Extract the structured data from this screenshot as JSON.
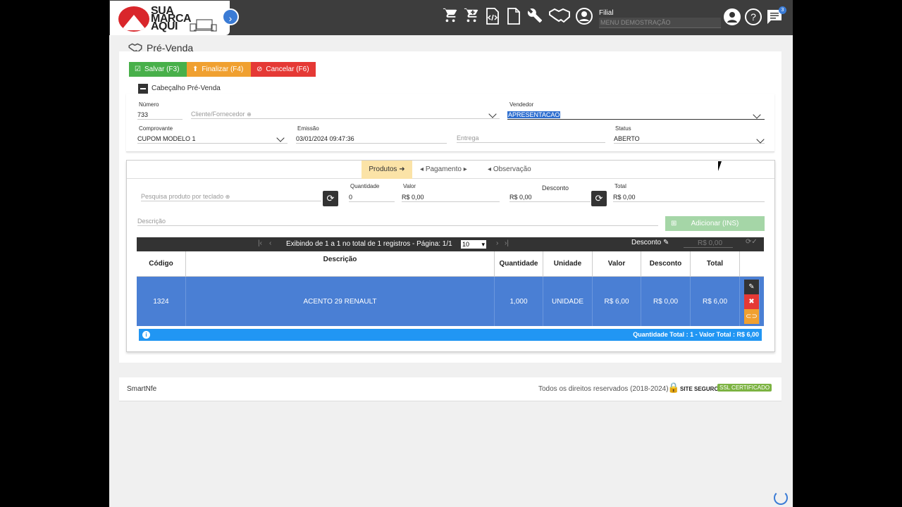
{
  "brand": {
    "logo_text_1": "SUA",
    "logo_text_2": "MARCA",
    "logo_text_3": "AQUI"
  },
  "header": {
    "filial_label": "Filial",
    "filial_value": "MENU DEMOSTRAÇÃO",
    "notification_count": "3"
  },
  "page": {
    "title": "Pré-Venda"
  },
  "toolbar": {
    "save_label": "Salvar (F3)",
    "finalize_label": "Finalizar (F4)",
    "cancel_label": "Cancelar (F6)"
  },
  "cabecalho": {
    "section_title": "Cabeçalho Pré-Venda",
    "numero_label": "Número",
    "numero_value": "733",
    "cliente_placeholder": "Cliente/Fornecedor",
    "vendedor_label": "Vendedor",
    "vendedor_value": "APRESENTACAO",
    "comprovante_label": "Comprovante",
    "comprovante_value": "CUPOM MODELO 1",
    "emissao_label": "Emissão",
    "emissao_value": "03/01/2024 09:47:36",
    "entrega_placeholder": "Entrega",
    "status_label": "Status",
    "status_value": "ABERTO"
  },
  "tabs": {
    "produtos": "Produtos",
    "pagamento": "Pagamento",
    "observacao": "Observação"
  },
  "produto_form": {
    "pesquisa_placeholder": "Pesquisa produto por teclado",
    "quantidade_label": "Quantidade",
    "quantidade_value": "0",
    "valor_label": "Valor",
    "valor_value": "R$ 0,00",
    "desconto_label": "Desconto",
    "desconto_value": "R$ 0,00",
    "total_label": "Total",
    "total_value": "R$ 0,00",
    "descricao_placeholder": "Descrição",
    "adicionar_label": "Adicionar (INS)"
  },
  "grid": {
    "pagination_text": "Exibindo de 1 a 1 no total de 1 registros - Página: 1/1",
    "page_size": "10",
    "desconto_label": "Desconto",
    "desconto_value": "R$ 0,00",
    "columns": [
      "Código",
      "Descrição",
      "Quantidade",
      "Unidade",
      "Valor",
      "Desconto",
      "Total"
    ],
    "rows": [
      {
        "codigo": "1324",
        "descricao": "ACENTO 29 RENAULT",
        "quantidade": "1,000",
        "unidade": "UNIDADE",
        "valor": "R$ 6,00",
        "desconto": "R$ 0,00",
        "total": "R$ 6,00"
      }
    ],
    "footer_text": "Quantidade Total : 1 - Valor Total : R$ 6,00"
  },
  "footer": {
    "app_name": "SmartNfe",
    "copyright": "Todos os direitos reservados (2018-2024)",
    "site_seguro": "SITE SEGURO",
    "ssl": "SSL CERTIFICADO"
  }
}
